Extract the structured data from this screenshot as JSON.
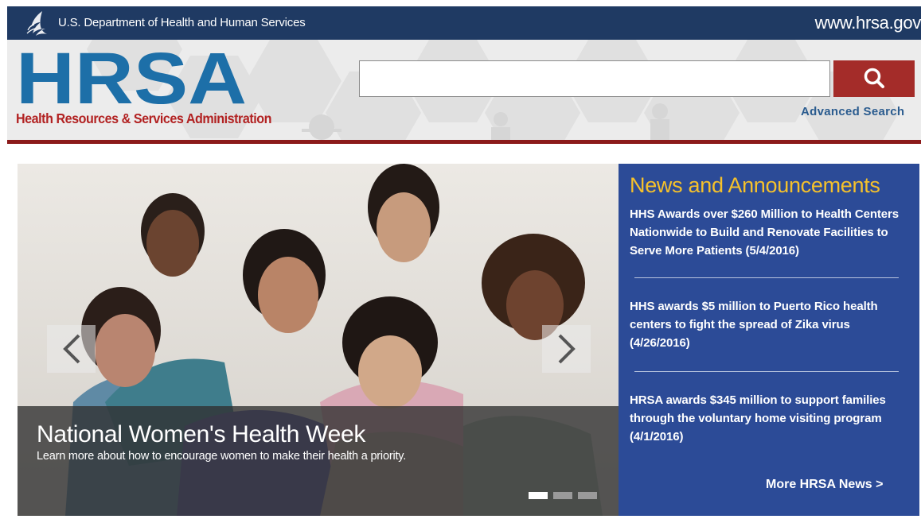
{
  "top_bar": {
    "department": "U.S. Department of Health and Human Services",
    "site_url": "www.hrsa.gov"
  },
  "header": {
    "logo_text": "HRSA",
    "tagline": "Health Resources & Services Administration",
    "search": {
      "value": "",
      "placeholder": ""
    },
    "search_icon": "magnifier-icon",
    "advanced_search": "Advanced Search"
  },
  "carousel": {
    "title": "National Women's Health Week",
    "subtitle": "Learn more about how to encourage women to make their health a priority.",
    "prev_icon": "chevron-left-icon",
    "next_icon": "chevron-right-icon",
    "slides": 3,
    "active_slide": 1
  },
  "news": {
    "heading": "News and Announcements",
    "items": [
      "HHS Awards over $260 Million to Health Centers Nationwide to Build and Renovate Facilities to Serve More Patients (5/4/2016)",
      "HHS awards $5 million to Puerto Rico health centers to fight the spread of Zika virus (4/26/2016)",
      "HRSA awards $345 million to support families through the voluntary home visiting program (4/1/2016)"
    ],
    "more_link": "More HRSA News >"
  },
  "colors": {
    "top_bar": "#1f3a63",
    "logo_blue": "#1d6fa8",
    "tagline_red": "#b22222",
    "search_button": "#a42c29",
    "news_panel": "#2c4b97",
    "news_heading": "#f5c12b",
    "header_rule": "#8b1a1a"
  }
}
